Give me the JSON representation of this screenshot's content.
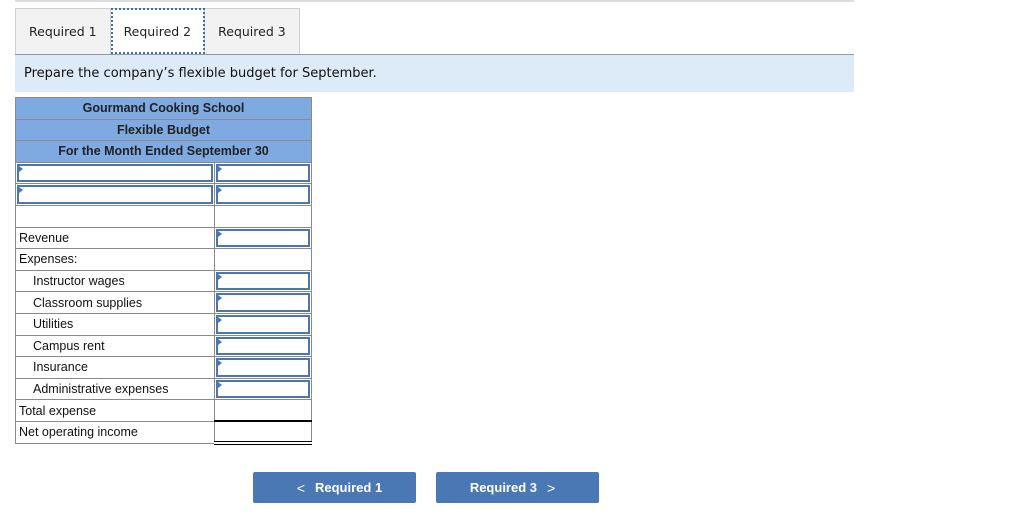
{
  "tabs": [
    {
      "label": "Required 1",
      "active": false
    },
    {
      "label": "Required 2",
      "active": true
    },
    {
      "label": "Required 3",
      "active": false
    }
  ],
  "prompt": "Prepare the company’s flexible budget for September.",
  "budget": {
    "company": "Gourmand Cooking School",
    "title": "Flexible Budget",
    "period": "For the Month Ended September 30",
    "rows": [
      {
        "label": "",
        "value": "",
        "label_input": true,
        "value_input": true
      },
      {
        "label": "",
        "value": "",
        "label_input": true,
        "value_input": true
      },
      {
        "label": "",
        "value": "",
        "label_input": false,
        "value_input": false
      },
      {
        "label": "Revenue",
        "value": "",
        "value_input": true
      },
      {
        "label": "Expenses:",
        "value": "",
        "value_input": false
      },
      {
        "label": "Instructor wages",
        "value": "",
        "value_input": true
      },
      {
        "label": "Classroom supplies",
        "value": "",
        "value_input": true
      },
      {
        "label": "Utilities",
        "value": "",
        "value_input": true
      },
      {
        "label": "Campus rent",
        "value": "",
        "value_input": true
      },
      {
        "label": "Insurance",
        "value": "",
        "value_input": true
      },
      {
        "label": "Administrative expenses",
        "value": "",
        "value_input": true
      },
      {
        "label": "Total expense",
        "value": "",
        "value_input": false
      },
      {
        "label": "Net operating income",
        "value": "",
        "value_input": false
      }
    ]
  },
  "nav": {
    "prev_label": "Required 1",
    "next_label": "Required 3",
    "prev_icon": "chevron-left-icon",
    "next_icon": "chevron-right-icon",
    "prev_glyph": "<",
    "next_glyph": ">"
  },
  "colors": {
    "header_bg": "#7ea9e1",
    "prompt_bg": "#ddeaf7",
    "button_bg": "#4a78b5",
    "input_border": "#4f76a8"
  }
}
